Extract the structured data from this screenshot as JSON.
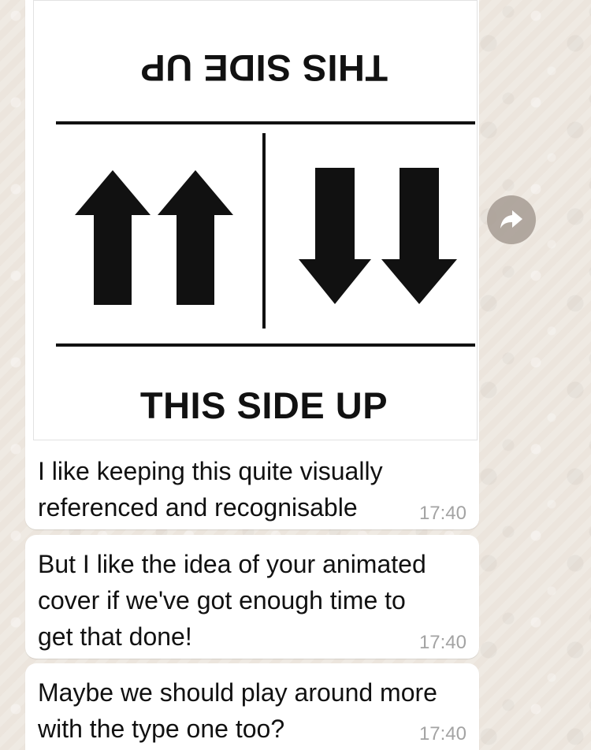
{
  "chat": {
    "image_message": {
      "top_label": "THIS SIDE UP",
      "bottom_label": "THIS SIDE UP"
    },
    "messages": [
      {
        "text": "I like keeping this quite visually\nreferenced and recognisable",
        "time": "17:40"
      },
      {
        "text": "But I like the idea of your animated\ncover if we've got enough time to\nget that done!",
        "time": "17:40"
      },
      {
        "text": "Maybe we should play around more\nwith the type one too?",
        "time": "17:40"
      }
    ],
    "forward_action": {
      "icon": "forward-arrow-icon"
    }
  },
  "colors": {
    "background": "#ece5dd",
    "bubble": "#ffffff",
    "timestamp": "#a3a3a3",
    "icon_button": "#aaa097",
    "ink": "#111111"
  }
}
